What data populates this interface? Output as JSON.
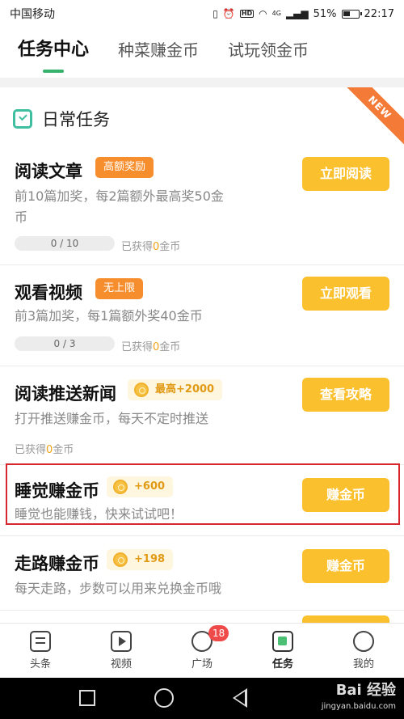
{
  "status": {
    "carrier": "中国移动",
    "signal_label": "4G",
    "battery": "51%",
    "time": "22:17"
  },
  "tabs": [
    {
      "label": "任务中心",
      "active": true
    },
    {
      "label": "种菜赚金币",
      "active": false
    },
    {
      "label": "试玩领金币",
      "active": false
    }
  ],
  "section": {
    "title": "日常任务",
    "ribbon": "NEW"
  },
  "tasks": [
    {
      "title": "阅读文章",
      "tag": "高额奖励",
      "desc1": "前10篇加奖，每2篇额外最高奖50金",
      "desc2": "币",
      "progress": "0 / 10",
      "earned_prefix": "已获得",
      "earned_num": "0",
      "earned_suffix": "金币",
      "button": "立即阅读"
    },
    {
      "title": "观看视频",
      "tag": "无上限",
      "desc1": "前3篇加奖，每1篇额外奖40金币",
      "progress": "0 / 3",
      "earned_prefix": "已获得",
      "earned_num": "0",
      "earned_suffix": "金币",
      "button": "立即观看"
    },
    {
      "title": "阅读推送新闻",
      "tag": "最高+2000",
      "desc1": "打开推送赚金币，每天不定时推送",
      "earned_prefix": "已获得",
      "earned_num": "0",
      "earned_suffix": "金币",
      "button": "查看攻略"
    },
    {
      "title": "睡觉赚金币",
      "tag": "+600",
      "desc1": "睡觉也能赚钱，快来试试吧！",
      "button": "赚金币"
    },
    {
      "title": "走路赚金币",
      "tag": "+198",
      "desc1": "每天走路，步数可以用来兑换金币哦",
      "button": "赚金币"
    }
  ],
  "bottom_nav": [
    {
      "label": "头条",
      "icon": "news-icon"
    },
    {
      "label": "视频",
      "icon": "video-icon"
    },
    {
      "label": "广场",
      "icon": "planet-icon",
      "badge": "18"
    },
    {
      "label": "任务",
      "icon": "task-icon",
      "active": true
    },
    {
      "label": "我的",
      "icon": "profile-icon"
    }
  ],
  "watermark": {
    "main": "Bai 经验",
    "sub": "jingyan.baidu.com"
  }
}
